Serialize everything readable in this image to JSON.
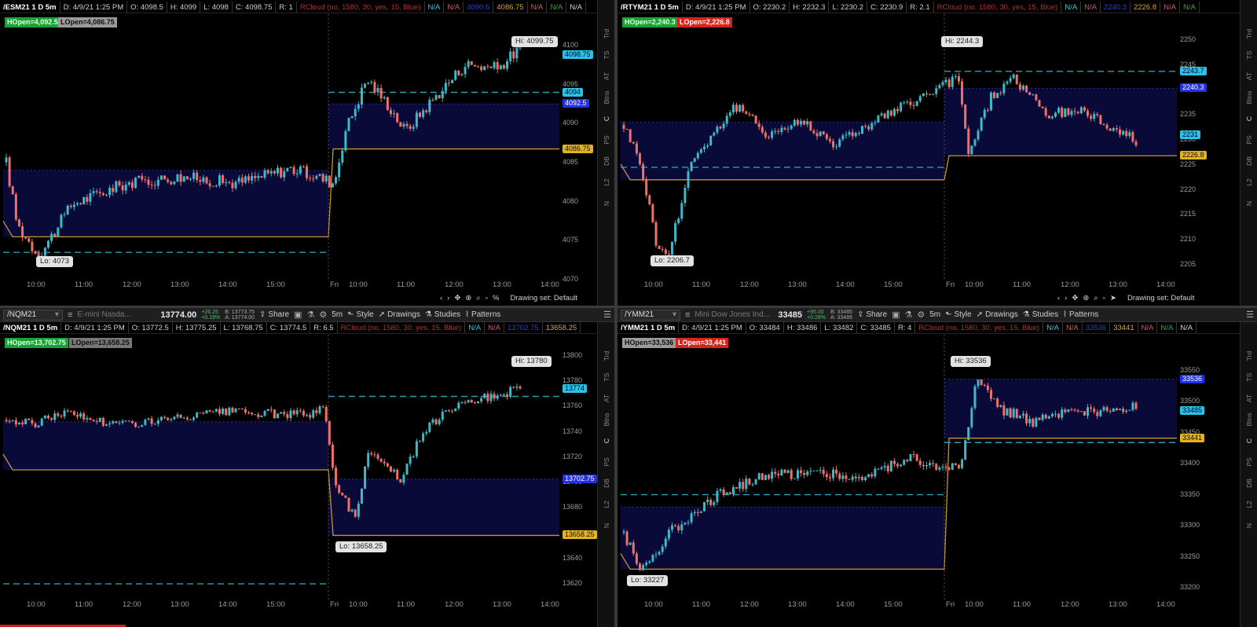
{
  "colors": {
    "bull": "#3fb8c8",
    "bear": "#f07068",
    "cyan_dash": "#29a0b3",
    "gold_line": "#c9962a",
    "blue_shade": "#0a0a38"
  },
  "drawing_set_label": "Drawing set: Default",
  "sidebar_items": [
    "Trd",
    "TS",
    "AT",
    "Btns",
    "C",
    "PS",
    "DB",
    "L2",
    "N"
  ],
  "sidebar_active": "C",
  "panels": [
    {
      "id": "esm",
      "info": {
        "title": "/ESM21 1 D 5m",
        "date": "D: 4/9/21 1:25 PM",
        "o": "O: 4098.5",
        "h": "H: 4099",
        "l": "L: 4098",
        "c": "C: 4098.75",
        "r": "R: 1",
        "cloud": "RCloud (no, 1580, 30, yes, 15, Blue)",
        "na1": "N/A",
        "na2": "N/A",
        "blue_val": "4090.5",
        "gold_val": "4086.75",
        "na3": "N/A",
        "na4": "N/A",
        "na5": "N/A"
      },
      "hopen": "HOpen=4,092.5",
      "lopen": "LOpen=4,086.75",
      "hi": "Hi: 4099.75",
      "lo": "Lo: 4073",
      "y_ticks": [
        "4100",
        "4095",
        "4090",
        "4085",
        "4080",
        "4075",
        "4070"
      ],
      "x_ticks": [
        "10:00",
        "11:00",
        "12:00",
        "13:00",
        "14:00",
        "15:00",
        "Fri",
        "10:00",
        "11:00",
        "12:00",
        "13:00",
        "14:00"
      ],
      "price_tags": [
        {
          "text": "4098.75",
          "style": "cyan"
        },
        {
          "text": "4094",
          "style": "cyan"
        },
        {
          "text": "4092.5",
          "style": "blue"
        },
        {
          "text": "4086.75",
          "style": "gold"
        }
      ],
      "chart_data": {
        "type": "candlestick",
        "y_range": [
          4070,
          4102
        ],
        "hi": 4099.75,
        "lo": 4073,
        "hopen": 4092.5,
        "lopen": 4086.75,
        "prev_hline": 4084,
        "prev_lline": 4075.5,
        "prev_dash": 4073.5,
        "cur_dash": 4094
      }
    },
    {
      "id": "rtym",
      "info": {
        "title": "/RTYM21 1 D 5m",
        "date": "D: 4/9/21 1:25 PM",
        "o": "O: 2230.2",
        "h": "H: 2232.3",
        "l": "L: 2230.2",
        "c": "C: 2230.9",
        "r": "R: 2.1",
        "cloud": "RCloud (no, 1580, 30, yes, 15, Blue)",
        "na1": "N/A",
        "na2": "N/A",
        "blue_val": "2240.3",
        "gold_val": "2226.8",
        "na3": "N/A",
        "na4": "N/A",
        "na5": "N/A"
      },
      "hopen": "HOpen=2,240.3",
      "lopen": "LOpen=2,226.8",
      "hi": "Hi: 2244.3",
      "lo": "Lo: 2206.7",
      "y_ticks": [
        "2250",
        "2245",
        "2240",
        "2235",
        "2230",
        "2225",
        "2220",
        "2215",
        "2210",
        "2205"
      ],
      "x_ticks": [
        "10:00",
        "11:00",
        "12:00",
        "13:00",
        "14:00",
        "15:00",
        "Fri",
        "10:00",
        "11:00",
        "12:00",
        "13:00",
        "14:00"
      ],
      "price_tags": [
        {
          "text": "2243.7",
          "style": "cyan"
        },
        {
          "text": "2240.3",
          "style": "blue"
        },
        {
          "text": "2231",
          "style": "cyan"
        },
        {
          "text": "2226.8",
          "style": "gold"
        }
      ],
      "chart_data": {
        "type": "candlestick",
        "y_range": [
          2202,
          2252
        ],
        "hi": 2244.3,
        "lo": 2206.7,
        "hopen": 2240.3,
        "lopen": 2226.8,
        "prev_hline": 2233.5,
        "prev_lline": 2222,
        "prev_dash": 2224.5,
        "cur_dash": 2243.7
      }
    },
    {
      "id": "nqm",
      "control": {
        "symbol": "/NQM21",
        "desc": "E-mini Nasda...",
        "last": "13774.00",
        "chg1": "+26.25",
        "chg2": "+0.19%",
        "bid": "B: 13773.75",
        "ask": "A: 13774.00",
        "interval": "5m"
      },
      "info": {
        "title": "/NQM21 1 D 5m",
        "date": "D: 4/9/21 1:25 PM",
        "o": "O: 13772.5",
        "h": "H: 13775.25",
        "l": "L: 13768.75",
        "c": "C: 13774.5",
        "r": "R: 6.5",
        "cloud": "RCloud (no, 1580, 30, yes, 15, Blue)",
        "na1": "N/A",
        "na2": "N/A",
        "blue_val": "13702.75",
        "gold_val": "13658.25",
        "na3": "",
        "na4": "",
        "na5": ""
      },
      "hopen": "HOpen=13,702.75",
      "lopen": "LOpen=13,658.25",
      "hi": "Hi: 13780",
      "lo": "Lo: 13658.25",
      "y_ticks": [
        "13800",
        "13780",
        "13760",
        "13740",
        "13720",
        "13700",
        "13680",
        "13660",
        "13640",
        "13620"
      ],
      "x_ticks": [
        "10:00",
        "11:00",
        "12:00",
        "13:00",
        "14:00",
        "15:00",
        "Fri",
        "10:00",
        "11:00",
        "12:00",
        "13:00",
        "14:00"
      ],
      "price_tags": [
        {
          "text": "13774",
          "style": "cyan"
        },
        {
          "text": "13702.75",
          "style": "blue"
        },
        {
          "text": "13658.25",
          "style": "gold"
        }
      ],
      "chart_data": {
        "type": "candlestick",
        "y_range": [
          13612,
          13808
        ],
        "hi": 13780,
        "lo": 13658.25,
        "hopen": 13702.75,
        "lopen": 13658.25,
        "prev_hline": 13748,
        "prev_lline": 13710,
        "prev_dash": 13620,
        "cur_dash": 13768
      }
    },
    {
      "id": "ymm",
      "control": {
        "symbol": "/YMM21",
        "desc": "Mini Dow Jones Ind...",
        "last": "33485",
        "chg1": "+95.00",
        "chg2": "+0.28%",
        "bid": "B: 33485",
        "ask": "A: 33486",
        "interval": "5m"
      },
      "info": {
        "title": "/YMM21 1 D 5m",
        "date": "D: 4/9/21 1:25 PM",
        "o": "O: 33484",
        "h": "H: 33486",
        "l": "L: 33482",
        "c": "C: 33485",
        "r": "R: 4",
        "cloud": "RCloud (no, 1580, 30, yes, 15, Blue)",
        "na1": "N/A",
        "na2": "N/A",
        "blue_val": "33536",
        "gold_val": "33441",
        "na3": "N/A",
        "na4": "N/A",
        "na5": "N/A"
      },
      "hopen": "HOpen=33,536",
      "lopen": "LOpen=33,441",
      "hi": "Hi: 33536",
      "lo": "Lo: 33227",
      "y_ticks": [
        "33550",
        "33500",
        "33450",
        "33400",
        "33350",
        "33300",
        "33250",
        "33200"
      ],
      "x_ticks": [
        "10:00",
        "11:00",
        "12:00",
        "13:00",
        "14:00",
        "15:00",
        "Fri",
        "10:00",
        "11:00",
        "12:00",
        "13:00",
        "14:00"
      ],
      "price_tags": [
        {
          "text": "33536",
          "style": "blue"
        },
        {
          "text": "33485",
          "style": "cyan"
        },
        {
          "text": "33441",
          "style": "gold"
        }
      ],
      "chart_data": {
        "type": "candlestick",
        "y_range": [
          33190,
          33590
        ],
        "hi": 33536,
        "lo": 33227,
        "hopen": 33536,
        "lopen": 33441,
        "prev_hline": 33330,
        "prev_lline": 33230,
        "prev_dash": 33350,
        "cur_dash": 33434
      }
    }
  ],
  "toolbar": {
    "share": "Share",
    "style": "Style",
    "drawings": "Drawings",
    "studies": "Studies",
    "patterns": "Patterns"
  }
}
